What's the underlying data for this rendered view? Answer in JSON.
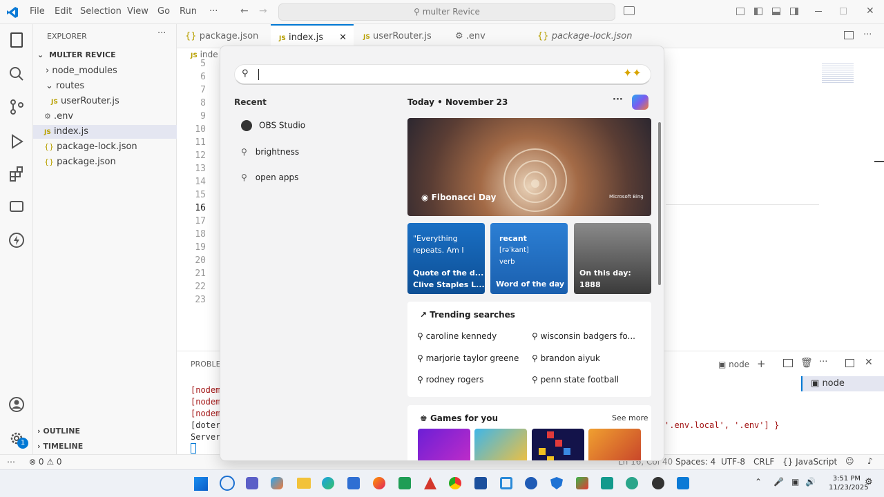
{
  "titlebar": {
    "menu": [
      "File",
      "Edit",
      "Selection",
      "View",
      "Go",
      "Run",
      "···"
    ],
    "search_text": "multer Revice"
  },
  "sidebar": {
    "header": "EXPLORER",
    "root": "MULTER REVICE",
    "items": [
      {
        "label": "node_modules"
      },
      {
        "label": "routes"
      },
      {
        "label": "userRouter.js"
      },
      {
        "label": ".env"
      },
      {
        "label": "index.js"
      },
      {
        "label": "package-lock.json"
      },
      {
        "label": "package.json"
      }
    ],
    "outline": "OUTLINE",
    "timeline": "TIMELINE"
  },
  "tabs": [
    {
      "label": "package.json"
    },
    {
      "label": "index.js"
    },
    {
      "label": "userRouter.js"
    },
    {
      "label": ".env"
    },
    {
      "label": "package-lock.json"
    }
  ],
  "editor": {
    "breadcrumb": "inde",
    "lines": [
      "5",
      "6",
      "7",
      "8",
      "9",
      "10",
      "11",
      "12",
      "13",
      "14",
      "15",
      "16",
      "17",
      "18",
      "19",
      "20",
      "21",
      "22",
      "23"
    ],
    "code_fragment": "'.env.local', '.env'] }"
  },
  "panel": {
    "tab_label": "PROBLEM",
    "terminal_lines": [
      "[nodem",
      "[nodem",
      "[nodem",
      "[doter",
      "Server"
    ],
    "node_label": "node",
    "node_item": "node"
  },
  "statusbar": {
    "errors": "0",
    "warnings": "0",
    "position": "Ln 16, Col 40",
    "spaces": "Spaces: 4",
    "encoding": "UTF-8",
    "eol": "CRLF",
    "language": "JavaScript",
    "badge": "1"
  },
  "flyout": {
    "recent_header": "Recent",
    "recent": [
      {
        "label": "OBS Studio"
      },
      {
        "label": "brightness"
      },
      {
        "label": "open apps"
      }
    ],
    "today_label": "Today",
    "date": "November 23",
    "hero": {
      "caption": "Fibonacci Day",
      "brand": "Microsoft Bing"
    },
    "cards": [
      {
        "line1": "\"Everything",
        "line2": "repeats. Am I",
        "title": "Quote of the d...",
        "subtitle": "Clive Staples L..."
      },
      {
        "line1": "recant",
        "line2": "[rəˈkant]",
        "line3": "verb",
        "title": "Word of the day"
      },
      {
        "title": "On this day:",
        "subtitle": "1888"
      }
    ],
    "trending_header": "Trending searches",
    "trending": [
      "caroline kennedy",
      "wisconsin badgers fo...",
      "marjorie taylor greene",
      "brandon aiyuk",
      "rodney rogers",
      "penn state football"
    ],
    "games_header": "Games for you",
    "see_more": "See more"
  },
  "taskbar": {
    "time": "3:51 PM",
    "date": "11/23/2025"
  },
  "colors": {
    "accent": "#0078d4",
    "card_quote": "#1666b8",
    "card_word": "#2a73c8"
  }
}
